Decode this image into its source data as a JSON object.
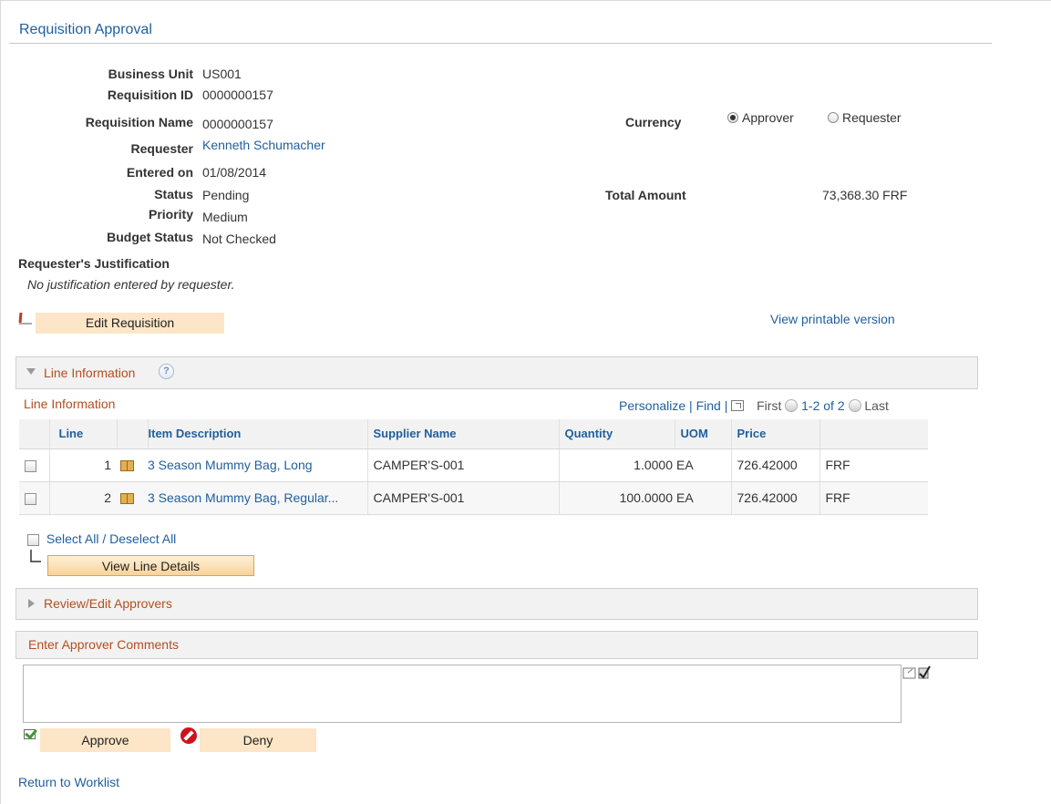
{
  "page": {
    "title": "Requisition Approval"
  },
  "header_fields": {
    "business_unit_label": "Business Unit",
    "business_unit_value": "US001",
    "requisition_id_label": "Requisition ID",
    "requisition_id_value": "0000000157",
    "requisition_name_label": "Requisition Name",
    "requisition_name_value": "0000000157",
    "requester_label": "Requester",
    "requester_value": "Kenneth Schumacher",
    "entered_on_label": "Entered on",
    "entered_on_value": "01/08/2014",
    "status_label": "Status",
    "status_value": "Pending",
    "priority_label": "Priority",
    "priority_value": "Medium",
    "budget_status_label": "Budget Status",
    "budget_status_value": "Not Checked",
    "currency_label": "Currency",
    "currency_options": [
      "Approver",
      "Requester"
    ],
    "currency_selected": "Approver",
    "total_amount_label": "Total Amount",
    "total_amount_value": "73,368.30 FRF"
  },
  "justification": {
    "label": "Requester's Justification",
    "text": "No justification entered by requester."
  },
  "actions": {
    "edit_requisition": "Edit Requisition",
    "view_printable": "View printable version"
  },
  "line_section": {
    "title": "Line Information",
    "help_icon": "?",
    "grid_title": "Line Information",
    "personalize": "Personalize",
    "find": "Find",
    "sep1": "|",
    "sep2": "|",
    "first": "First",
    "range": "1-2 of 2",
    "last": "Last",
    "columns": [
      "Line",
      "Item Description",
      "Supplier Name",
      "Quantity",
      "UOM",
      "Price"
    ],
    "rows": [
      {
        "line": "1",
        "item": "3 Season Mummy Bag, Long",
        "supplier": "CAMPER'S-001",
        "quantity": "1.0000",
        "uom": "EA",
        "price": "726.42000",
        "currency": "FRF"
      },
      {
        "line": "2",
        "item": "3 Season Mummy Bag, Regular...",
        "supplier": "CAMPER'S-001",
        "quantity": "100.0000",
        "uom": "EA",
        "price": "726.42000",
        "currency": "FRF"
      }
    ],
    "select_all": "Select All / Deselect All",
    "view_line_details": "View Line Details"
  },
  "approvers_section": {
    "title": "Review/Edit Approvers"
  },
  "comments_section": {
    "title": "Enter Approver Comments",
    "value": ""
  },
  "decision": {
    "approve": "Approve",
    "deny": "Deny"
  },
  "footer": {
    "return_link": "Return to Worklist"
  },
  "colors": {
    "link": "#1f5f9e",
    "section_title": "#b34f1f",
    "button_bg": "#fce6c7",
    "deny_red": "#d0121b"
  }
}
